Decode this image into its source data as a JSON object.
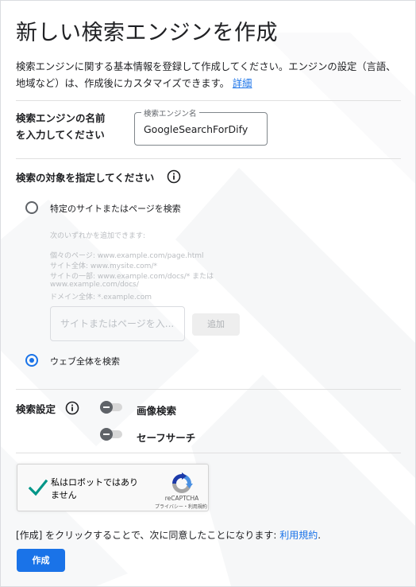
{
  "title": "新しい検索エンジンを作成",
  "intro": {
    "text": "検索エンジンに関する基本情報を登録して作成してください。エンジンの設定（言語、地域など）は、作成後にカスタマイズできます。",
    "link": "詳細"
  },
  "name": {
    "label_line1": "検索エンジンの名前",
    "label_line2": "を入力してください",
    "field_label": "検索エンジン名",
    "value": "GoogleSearchForDify"
  },
  "target": {
    "title": "検索の対象を指定してください",
    "option_specific": "特定のサイトまたはページを検索",
    "hints": [
      "次のいずれかを追加できます:",
      "個々のページ: www.example.com/page.html",
      "サイト全体: www.mysite.com/*",
      "サイトの一部: www.example.com/docs/* または",
      "www.example.com/docs/",
      "ドメイン全体: *.example.com"
    ],
    "site_placeholder": "サイトまたはページを入...",
    "add_label": "追加",
    "option_all": "ウェブ全体を検索",
    "selected": "option_all"
  },
  "settings": {
    "label": "検索設定",
    "toggles": [
      {
        "label": "画像検索",
        "on": false
      },
      {
        "label": "セーフサーチ",
        "on": false
      }
    ]
  },
  "captcha": {
    "text": "私はロボットではありません",
    "brand": "reCAPTCHA",
    "terms": "プライバシー・利用規約",
    "checked": true
  },
  "agreement": {
    "text": "[作成] をクリックすることで、次に同意したことになります: ",
    "link": "利用規約",
    "suffix": "."
  },
  "create_label": "作成",
  "colors": {
    "accent": "#1a73e8",
    "check": "#009688"
  }
}
